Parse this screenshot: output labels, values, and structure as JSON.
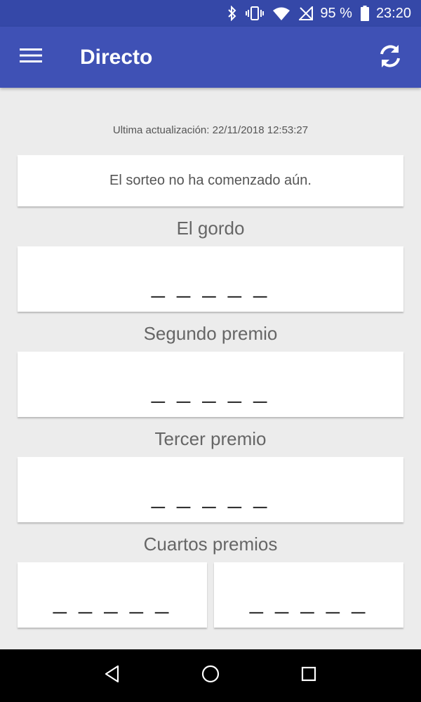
{
  "status_bar": {
    "battery_percent": "95 %",
    "time": "23:20",
    "icons": [
      "bluetooth-icon",
      "vibrate-icon",
      "wifi-icon",
      "no-signal-icon",
      "battery-icon"
    ]
  },
  "app_bar": {
    "title": "Directo",
    "icons": [
      "menu-icon",
      "refresh-icon"
    ]
  },
  "main": {
    "last_update": "Ultima actualización: 22/11/2018 12:53:27",
    "status_message": "El sorteo no ha comenzado aún.",
    "prizes": [
      {
        "label": "El gordo",
        "number": "_ _ _ _ _"
      },
      {
        "label": "Segundo premio",
        "number": "_ _ _ _ _"
      },
      {
        "label": "Tercer premio",
        "number": "_ _ _ _ _"
      }
    ],
    "cuartos": {
      "label": "Cuartos premios",
      "numbers": [
        "_ _ _ _ _",
        "_ _ _ _ _"
      ]
    }
  },
  "nav_bar": {
    "icons": [
      "back-icon",
      "home-icon",
      "recents-icon"
    ]
  },
  "colors": {
    "primary": "#3f51b5",
    "status_bar": "#3548a8",
    "background": "#ececec"
  }
}
